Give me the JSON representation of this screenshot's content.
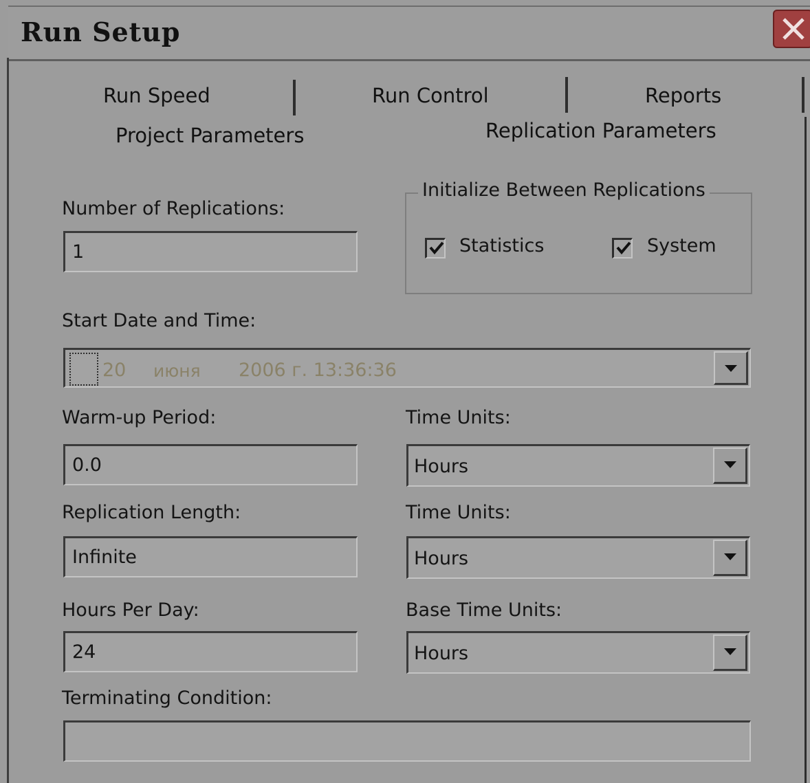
{
  "window": {
    "title": "Run Setup"
  },
  "tabs": {
    "row1": [
      "Run Speed",
      "Run Control",
      "Reports"
    ],
    "row2": [
      "Project Parameters",
      "Replication Parameters"
    ],
    "active": "Replication Parameters"
  },
  "form": {
    "num_replications": {
      "label": "Number of Replications:",
      "value": "1"
    },
    "init_group": {
      "title": "Initialize Between Replications",
      "statistics": {
        "label": "Statistics",
        "checked": true
      },
      "system": {
        "label": "System",
        "checked": true
      }
    },
    "start_date": {
      "label": "Start Date and Time:",
      "day": "20",
      "month": "июня",
      "year_time": "2006 г. 13:36:36",
      "enabled": false
    },
    "warmup": {
      "label": "Warm-up Period:",
      "value": "0.0",
      "units_label": "Time Units:",
      "units_value": "Hours"
    },
    "rep_length": {
      "label": "Replication Length:",
      "value": "Infinite",
      "units_label": "Time Units:",
      "units_value": "Hours"
    },
    "hours_per_day": {
      "label": "Hours Per Day:",
      "value": "24",
      "units_label": "Base Time Units:",
      "units_value": "Hours"
    },
    "terminating": {
      "label": "Terminating Condition:",
      "value": ""
    }
  },
  "colors": {
    "background": "#9c9c9c",
    "close_button": "#a04040",
    "disabled_text": "#8a8268"
  },
  "icons": {
    "close": "close-icon",
    "dropdown": "chevron-down-icon",
    "check": "checkmark-icon"
  }
}
